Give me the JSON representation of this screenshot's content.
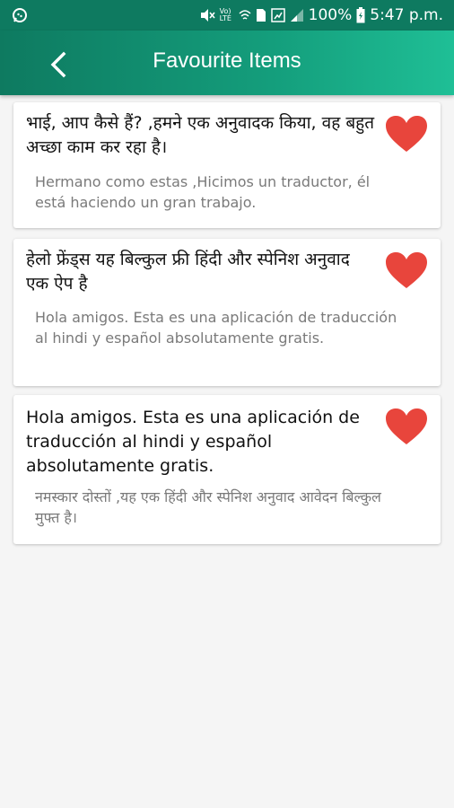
{
  "status_bar": {
    "battery": "100%",
    "time": "5:47 p.m.",
    "volte": "Vo) LTE"
  },
  "app_bar": {
    "title": "Favourite Items",
    "back_icon": "chevron-left-icon"
  },
  "items": [
    {
      "title": "भाई, आप कैसे हैं?  ,हमने एक अनुवादक किया, वह बहुत अच्छा काम कर रहा है।",
      "translation": "Hermano como estas  ,Hicimos un traductor, él está haciendo un gran trabajo.",
      "favourite_icon": "heart-icon"
    },
    {
      "title": "हेलो फ्रेंड्स यह बिल्कुल फ्री हिंदी और स्पेनिश अनुवाद एक ऐप है",
      "translation": "Hola amigos. Esta es una aplicación de traducción al hindi y español absolutamente gratis.",
      "favourite_icon": "heart-icon"
    },
    {
      "title": "Hola amigos. Esta es una aplicación de traducción al hindi y español absolutamente gratis.",
      "translation": "नमस्कार दोस्तों ,यह एक हिंदी और स्पेनिश अनुवाद आवेदन बिल्कुल मुफ्त है।",
      "favourite_icon": "heart-icon"
    }
  ],
  "colors": {
    "status_bar": "#0e7a60",
    "app_bar_start": "#0e7a60",
    "app_bar_end": "#1fbf96",
    "heart": "#e8453c",
    "background": "#f5f5f5"
  }
}
